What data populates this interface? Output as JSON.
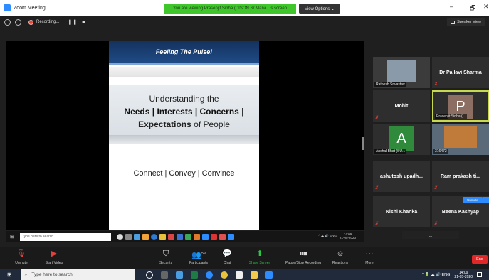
{
  "window": {
    "title": "Zoom Meeting",
    "banner": "You are viewing Prasenjit Sinha (DISON Sr Mana...'s screen",
    "view_options": "View Options ⌄",
    "min": "–",
    "max": "🗗",
    "close": "✕"
  },
  "topbar": {
    "recording": "Recording...",
    "pause": "❚❚",
    "stop": "■",
    "speaker_view": "Speaker View"
  },
  "slide": {
    "header": "Feeling The Pulse!",
    "line1": "Understanding the",
    "line2": "Needs | Interests | Concerns |",
    "line3_bold": "Expectations",
    "line3_rest": " of People",
    "footer": "Connect | Convey | Convince"
  },
  "mini_taskbar": {
    "search": "Type here to search",
    "tray": "^ ☁ 🔊 ENG",
    "time": "14:09",
    "date": "21-05-2020"
  },
  "participants": [
    {
      "name": "Ratnesh Srivastav",
      "kind": "video"
    },
    {
      "name": "Dr Pallavi Sharma",
      "kind": "name"
    },
    {
      "name": "Mohit",
      "kind": "name"
    },
    {
      "name": "Prasenjit Sinha (...",
      "kind": "avatar",
      "letter": "P"
    },
    {
      "name": "Anchal Bhat (SU...",
      "kind": "avatar",
      "letter": "A"
    },
    {
      "name": "316472",
      "kind": "video"
    },
    {
      "name": "ashutosh upadh...",
      "kind": "name"
    },
    {
      "name": "Ram prakash ti...",
      "kind": "name"
    },
    {
      "name": "Nishi Khanka",
      "kind": "name"
    },
    {
      "name": "Beena Kashyap",
      "kind": "name"
    }
  ],
  "unmute_btn": "Unmute",
  "more_btn": "···",
  "chevron": "⌄",
  "meeting_toolbar": {
    "unmute": "Unmute",
    "start_video": "Start Video",
    "security": "Security",
    "participants": "Participants",
    "participant_count": "59",
    "chat": "Chat",
    "share_screen": "Share Screen",
    "pause_recording": "Pause/Stop Recording",
    "reactions": "Reactions",
    "more": "More",
    "end": "End"
  },
  "windows_taskbar": {
    "search": "Type here to search",
    "tray": "^ 🔋 ☁ 🔊 ENG",
    "time": "14:09",
    "date": "21-05-2020"
  },
  "colors": {
    "zoom_blue": "#2d8cff",
    "banner_green": "#3ec62b",
    "end_red": "#e02828",
    "active_speaker": "#c9d94e"
  }
}
